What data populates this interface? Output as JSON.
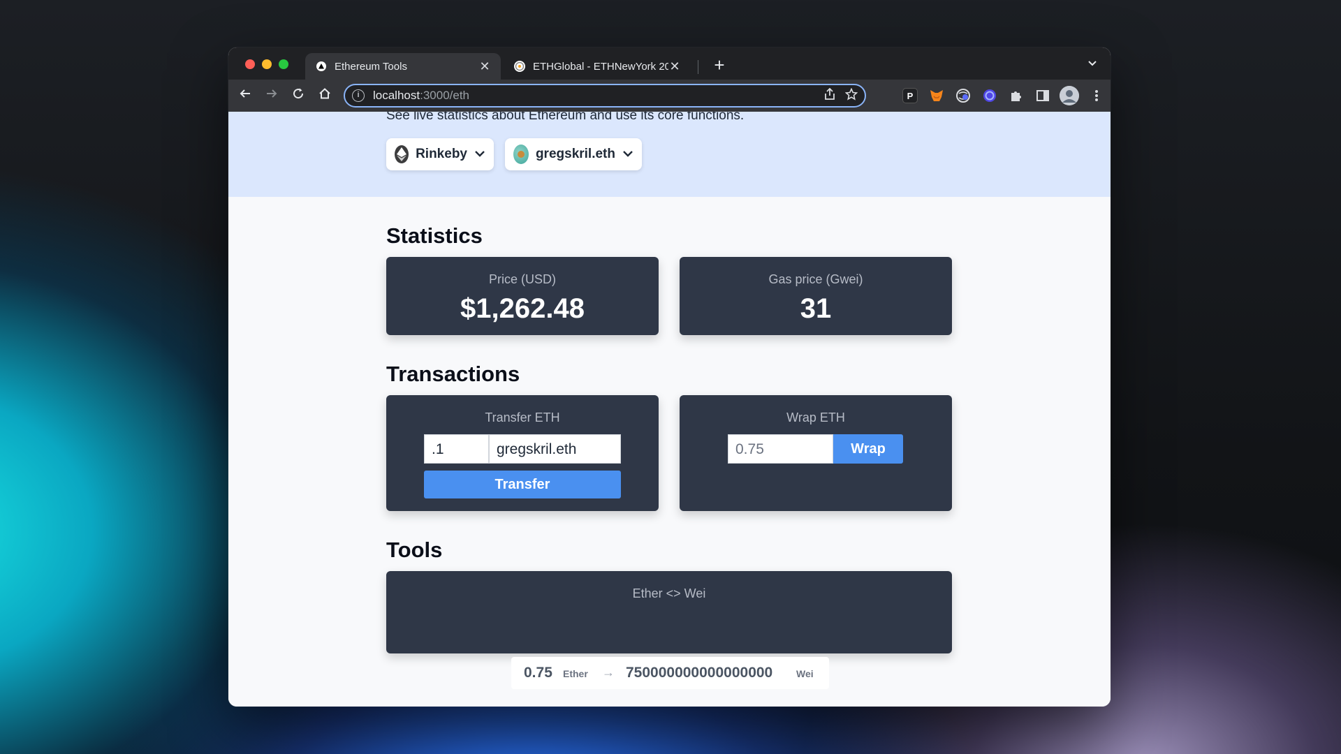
{
  "browser": {
    "tabs": [
      {
        "title": "Ethereum Tools",
        "active": true,
        "close": "✕"
      },
      {
        "title": "ETHGlobal - ETHNewYork 2022",
        "active": false,
        "close": "✕"
      }
    ],
    "new_tab": "+",
    "tab_menu": "⌄",
    "url_host": "localhost",
    "url_path": ":3000/eth",
    "info_glyph": "i",
    "extensions": [
      "P"
    ]
  },
  "header": {
    "subtitle": "See live statistics about Ethereum and use its core functions.",
    "network_label": "Rinkeby",
    "account_label": "gregskril.eth"
  },
  "statistics": {
    "title": "Statistics",
    "price_label": "Price (USD)",
    "price_value": "$1,262.48",
    "gas_label": "Gas price (Gwei)",
    "gas_value": "31"
  },
  "transactions": {
    "title": "Transactions",
    "transfer_label": "Transfer ETH",
    "transfer_amount": ".1",
    "transfer_recipient": "gregskril.eth",
    "transfer_button": "Transfer",
    "wrap_label": "Wrap ETH",
    "wrap_amount": "0.75",
    "wrap_button": "Wrap"
  },
  "tools": {
    "title": "Tools",
    "converter_label": "Ether <> Wei",
    "ether_value": "0.75",
    "ether_unit": "Ether",
    "arrow": "→",
    "wei_value": "750000000000000000",
    "wei_unit": "Wei"
  },
  "colors": {
    "accent": "#4a90f0",
    "card_bg": "#2f3747",
    "hero_bg": "#dbe7fd"
  }
}
